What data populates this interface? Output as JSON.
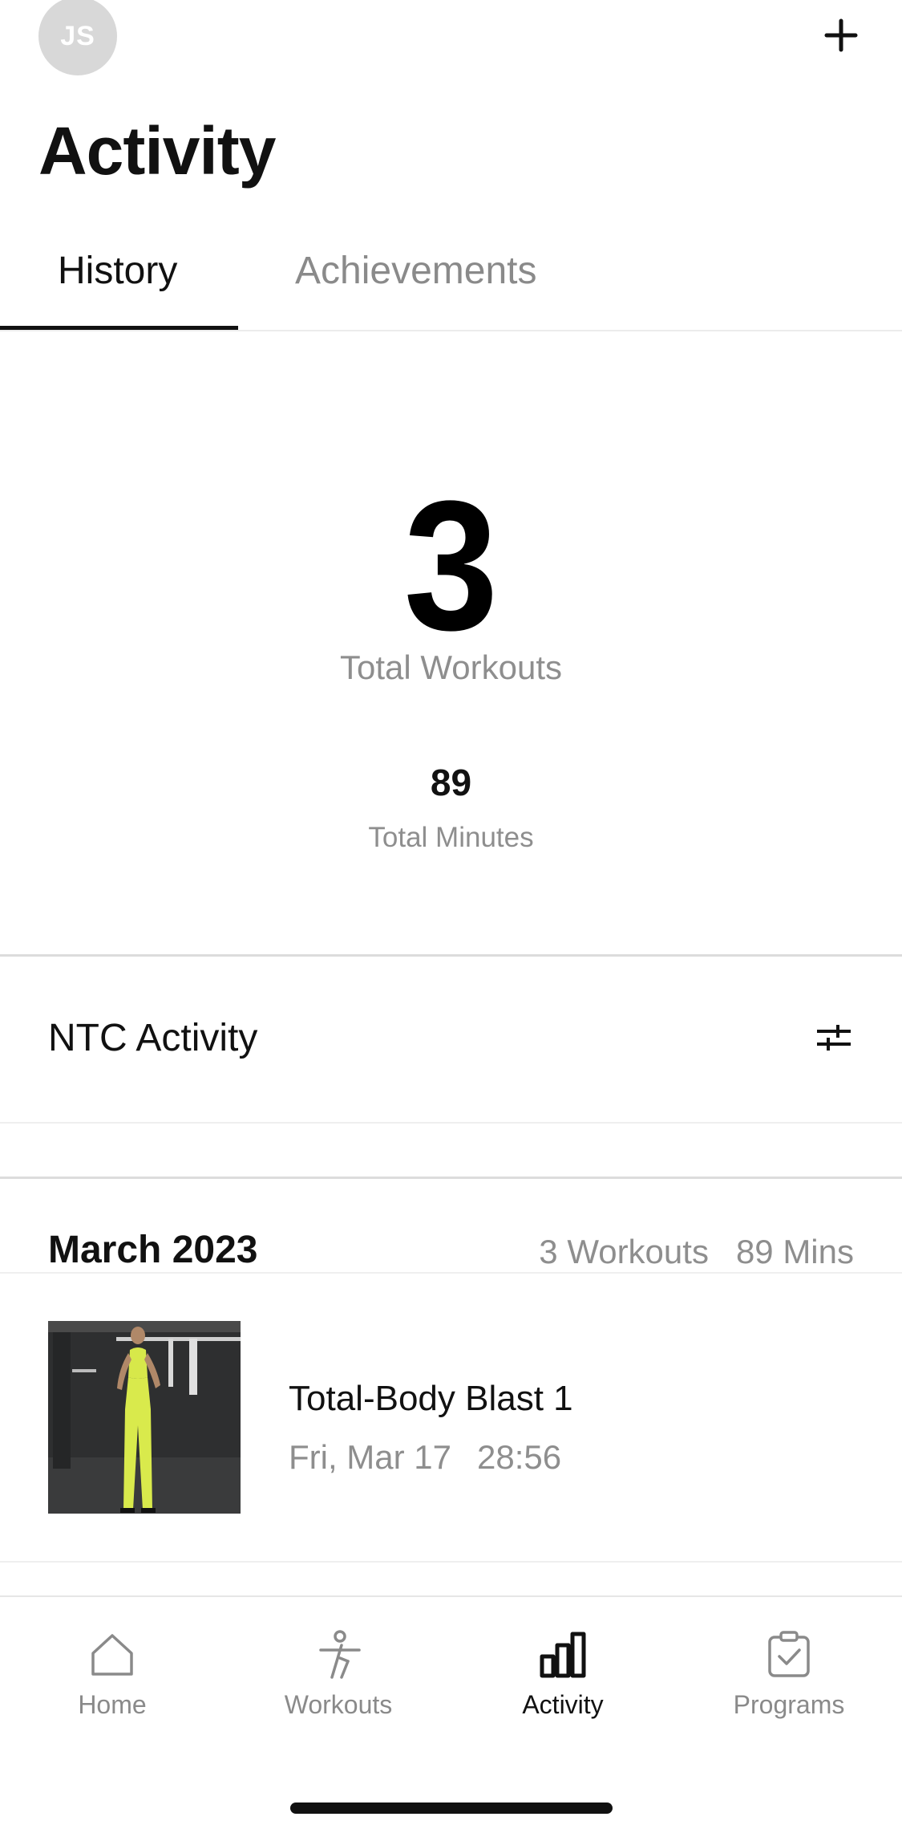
{
  "header": {
    "avatar_initials": "JS",
    "add_icon": "plus-icon",
    "title": "Activity"
  },
  "tabs": [
    {
      "label": "History",
      "active": true
    },
    {
      "label": "Achievements",
      "active": false
    }
  ],
  "summary": {
    "total_workouts_value": "3",
    "total_workouts_label": "Total Workouts",
    "total_minutes_value": "89",
    "total_minutes_label": "Total Minutes"
  },
  "section": {
    "title": "NTC Activity",
    "filter_icon": "sliders-icon"
  },
  "month_group": {
    "month": "March 2023",
    "workouts": "3 Workouts",
    "minutes": "89 Mins"
  },
  "workout_item": {
    "name": "Total-Body Blast 1",
    "date": "Fri, Mar 17",
    "duration": "28:56"
  },
  "bottom_nav": [
    {
      "label": "Home",
      "icon": "home-icon",
      "active": false
    },
    {
      "label": "Workouts",
      "icon": "running-figure-icon",
      "active": false
    },
    {
      "label": "Activity",
      "icon": "bar-chart-icon",
      "active": true
    },
    {
      "label": "Programs",
      "icon": "clipboard-check-icon",
      "active": false
    }
  ],
  "colors": {
    "accent_text": "#111111",
    "muted_text": "#8e8e8e",
    "avatar_bg": "#d8d8d8"
  }
}
